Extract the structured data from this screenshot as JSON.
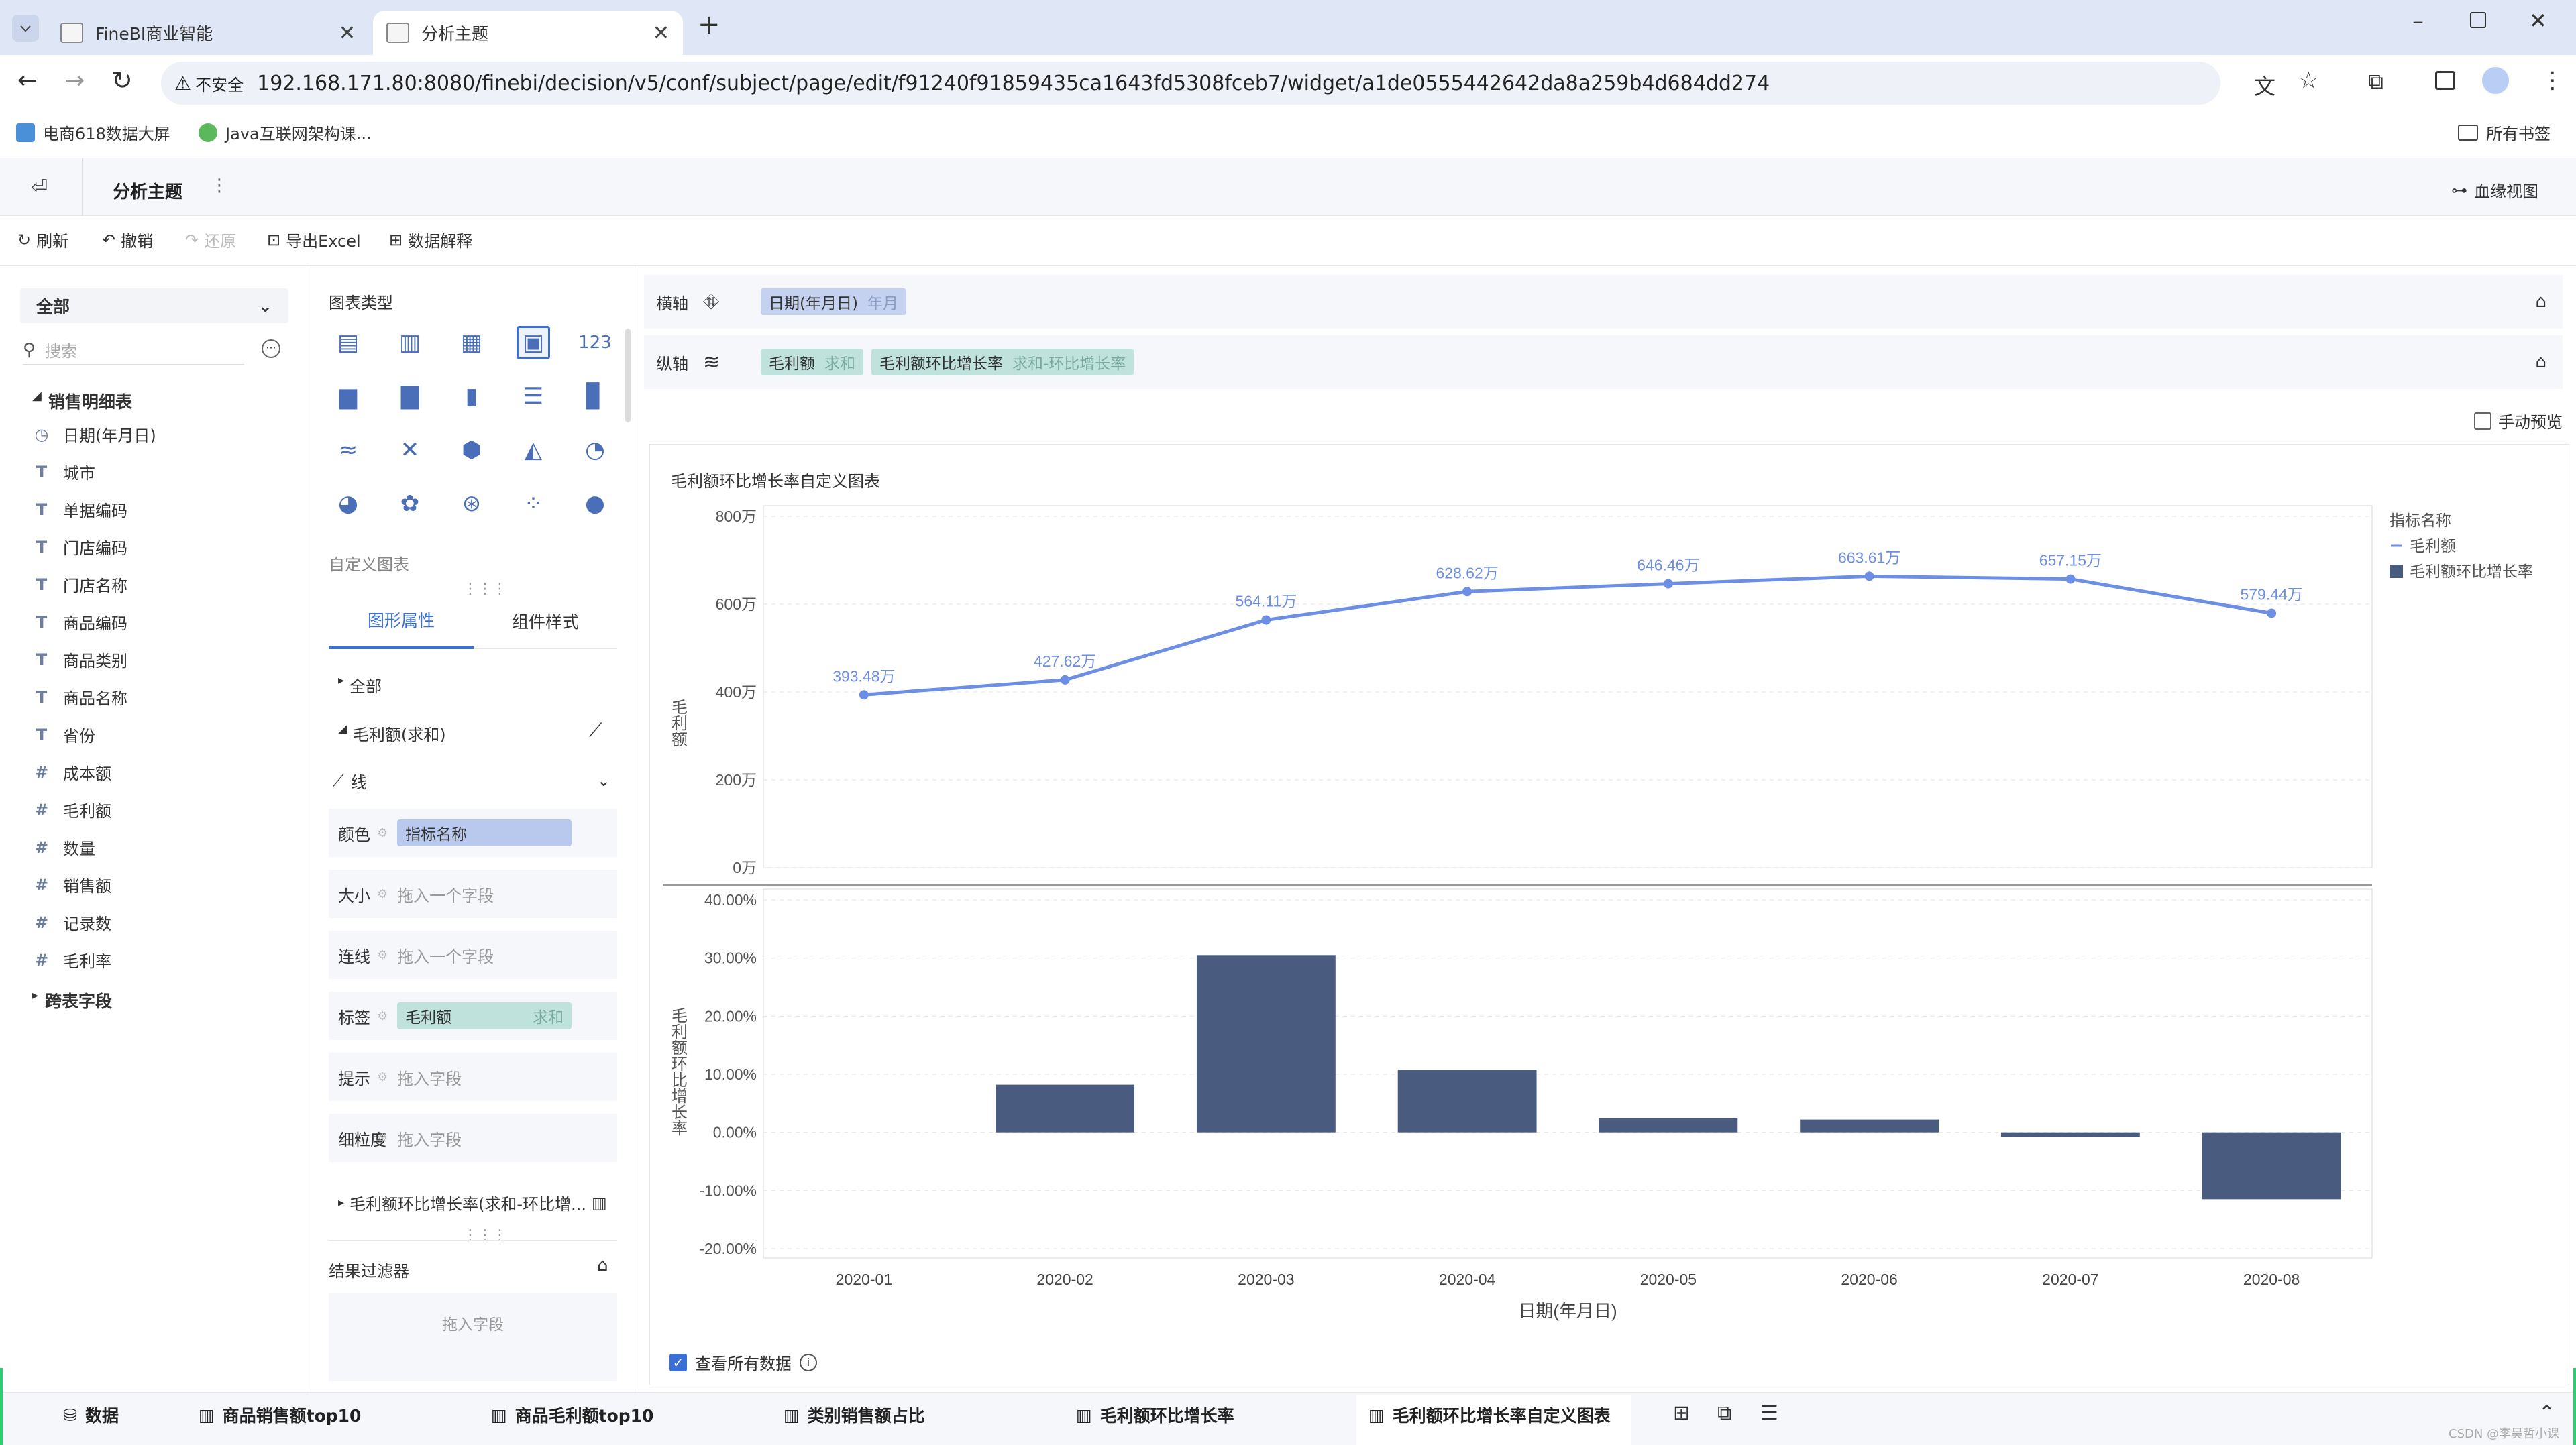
{
  "browser": {
    "tabs": [
      {
        "label": "FineBI商业智能"
      },
      {
        "label": "分析主题"
      }
    ],
    "security_label": "不安全",
    "url": "192.168.171.80:8080/finebi/decision/v5/conf/subject/page/edit/f91240f91859435ca1643fd5308fceb7/widget/a1de0555442642da8a259b4d684dd274",
    "bookmarks": [
      {
        "label": "电商618数据大屏"
      },
      {
        "label": "Java互联网架构课..."
      }
    ],
    "all_bookmarks": "所有书签"
  },
  "app": {
    "title": "分析主题",
    "lineage_view": "血缘视图",
    "toolbar": {
      "refresh": "刷新",
      "undo": "撤销",
      "redo": "还原",
      "export": "导出Excel",
      "explain": "数据解释"
    }
  },
  "fields": {
    "scope": "全部",
    "search_placeholder": "搜索",
    "table_name": "销售明细表",
    "items": [
      {
        "type": "◷",
        "label": "日期(年月日)"
      },
      {
        "type": "T",
        "label": "城市"
      },
      {
        "type": "T",
        "label": "单据编码"
      },
      {
        "type": "T",
        "label": "门店编码"
      },
      {
        "type": "T",
        "label": "门店名称"
      },
      {
        "type": "T",
        "label": "商品编码"
      },
      {
        "type": "T",
        "label": "商品类别"
      },
      {
        "type": "T",
        "label": "商品名称"
      },
      {
        "type": "T",
        "label": "省份"
      },
      {
        "type": "#",
        "label": "成本额"
      },
      {
        "type": "#",
        "label": "毛利额"
      },
      {
        "type": "#",
        "label": "数量"
      },
      {
        "type": "#",
        "label": "销售额"
      },
      {
        "type": "#",
        "label": "记录数"
      },
      {
        "type": "#",
        "label": "毛利率"
      }
    ],
    "cross_table": "跨表字段"
  },
  "config": {
    "chart_type_label": "图表类型",
    "custom_chart_label": "自定义图表",
    "tabs": [
      "图形属性",
      "组件样式"
    ],
    "all_label": "全部",
    "measure1": "毛利额(求和)",
    "mark_type": "线",
    "props": [
      {
        "label": "颜色",
        "value": "指标名称",
        "kind": "blue"
      },
      {
        "label": "大小",
        "value": "拖入一个字段",
        "kind": "ph"
      },
      {
        "label": "连线",
        "value": "拖入一个字段",
        "kind": "ph"
      },
      {
        "label": "标签",
        "value": "毛利额",
        "sub": "求和",
        "kind": "green"
      },
      {
        "label": "提示",
        "value": "拖入字段",
        "kind": "ph"
      },
      {
        "label": "细粒度",
        "value": "拖入字段",
        "kind": "ph"
      }
    ],
    "measure2": "毛利额环比增长率(求和-环比增...",
    "filter_label": "结果过滤器",
    "filter_placeholder": "拖入字段"
  },
  "axes": {
    "x_label": "横轴",
    "x_field": "日期(年月日)",
    "x_sub": "年月",
    "y_label": "纵轴",
    "y_fields": [
      {
        "name": "毛利额",
        "sub": "求和"
      },
      {
        "name": "毛利额环比增长率",
        "sub": "求和-环比增长率"
      }
    ],
    "manual_preview": "手动预览"
  },
  "chart_data": {
    "title": "毛利额环比增长率自定义图表",
    "type": "line+bar",
    "categories": [
      "2020-01",
      "2020-02",
      "2020-03",
      "2020-04",
      "2020-05",
      "2020-06",
      "2020-07",
      "2020-08"
    ],
    "xlabel": "日期(年月日)",
    "legend_title": "指标名称",
    "legend_position": "top-right",
    "series": [
      {
        "name": "毛利额",
        "type": "line",
        "values": [
          393.48,
          427.62,
          564.11,
          628.62,
          646.46,
          663.61,
          657.15,
          579.44
        ],
        "labels": [
          "393.48万",
          "427.62万",
          "564.11万",
          "628.62万",
          "646.46万",
          "663.61万",
          "657.15万",
          "579.44万"
        ],
        "ylabel": "毛利额",
        "ylim": [
          0,
          800
        ],
        "yticks": [
          "800万",
          "600万",
          "400万",
          "200万",
          "0万"
        ],
        "color": "#6d8ee5"
      },
      {
        "name": "毛利额环比增长率",
        "type": "bar",
        "values": [
          0,
          8.2,
          30.5,
          10.8,
          2.4,
          2.2,
          -0.8,
          -11.5
        ],
        "ylabel": "毛利额环比增长率",
        "ylim": [
          -20,
          40
        ],
        "yticks": [
          "40.00%",
          "30.00%",
          "20.00%",
          "10.00%",
          "0.00%",
          "-10.00%",
          "-20.00%"
        ],
        "color": "#4a5b80"
      }
    ],
    "grid": true
  },
  "view_all_data": "查看所有数据",
  "bottom_tabs": [
    {
      "label": "数据"
    },
    {
      "label": "商品销售额top10"
    },
    {
      "label": "商品毛利额top10"
    },
    {
      "label": "类别销售额占比"
    },
    {
      "label": "毛利额环比增长率"
    },
    {
      "label": "毛利额环比增长率自定义图表"
    }
  ],
  "watermark": "CSDN @李昊哲小课"
}
